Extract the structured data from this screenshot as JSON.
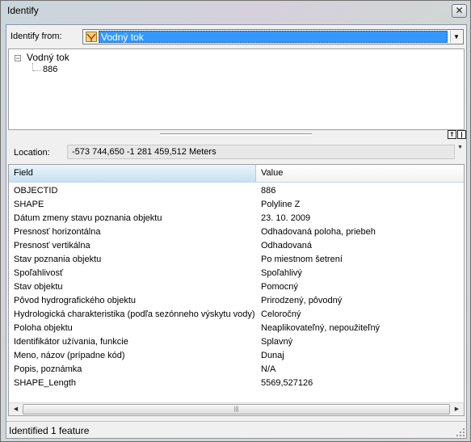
{
  "window": {
    "title": "Identify",
    "close_glyph": "✕"
  },
  "identify_from": {
    "label": "Identify from:",
    "value": "Vodný tok",
    "icon": "layer-icon"
  },
  "tree": {
    "root_label": "Vodný tok",
    "expander": "−",
    "children": [
      "886"
    ]
  },
  "location": {
    "label": "Location:",
    "value": "-573 744,650  -1 281 459,512 Meters"
  },
  "grid": {
    "columns": [
      "Field",
      "Value"
    ],
    "rows": [
      {
        "field": "OBJECTID",
        "value": "886"
      },
      {
        "field": "SHAPE",
        "value": "Polyline Z"
      },
      {
        "field": "Dátum zmeny stavu poznania objektu",
        "value": "23. 10. 2009"
      },
      {
        "field": "Presnosť horizontálna",
        "value": "Odhadovaná poloha, priebeh"
      },
      {
        "field": "Presnosť vertikálna",
        "value": "Odhadovaná"
      },
      {
        "field": "Stav poznania objektu",
        "value": "Po miestnom šetrení"
      },
      {
        "field": "Spoľahlivosť",
        "value": "Spoľahlivý"
      },
      {
        "field": "Stav objektu",
        "value": "Pomocný"
      },
      {
        "field": "Pôvod hydrografického objektu",
        "value": "Prirodzený, pôvodný"
      },
      {
        "field": "Hydrologická charakteristika (podľa sezónneho výskytu vody)",
        "value": "Celoročný"
      },
      {
        "field": "Poloha objektu",
        "value": "Neaplikovateľný, nepoužiteľný"
      },
      {
        "field": "Identifikátor užívania, funkcie",
        "value": "Splavný"
      },
      {
        "field": "Meno, názov (prípadne kód)",
        "value": "Dunaj"
      },
      {
        "field": "Popis, poznámka",
        "value": "N/A"
      },
      {
        "field": "SHAPE_Length",
        "value": "5569,527126"
      }
    ]
  },
  "status": {
    "text": "Identified 1 feature"
  },
  "colors": {
    "selection": "#3399ff",
    "header_field": "#c6e0f3"
  }
}
